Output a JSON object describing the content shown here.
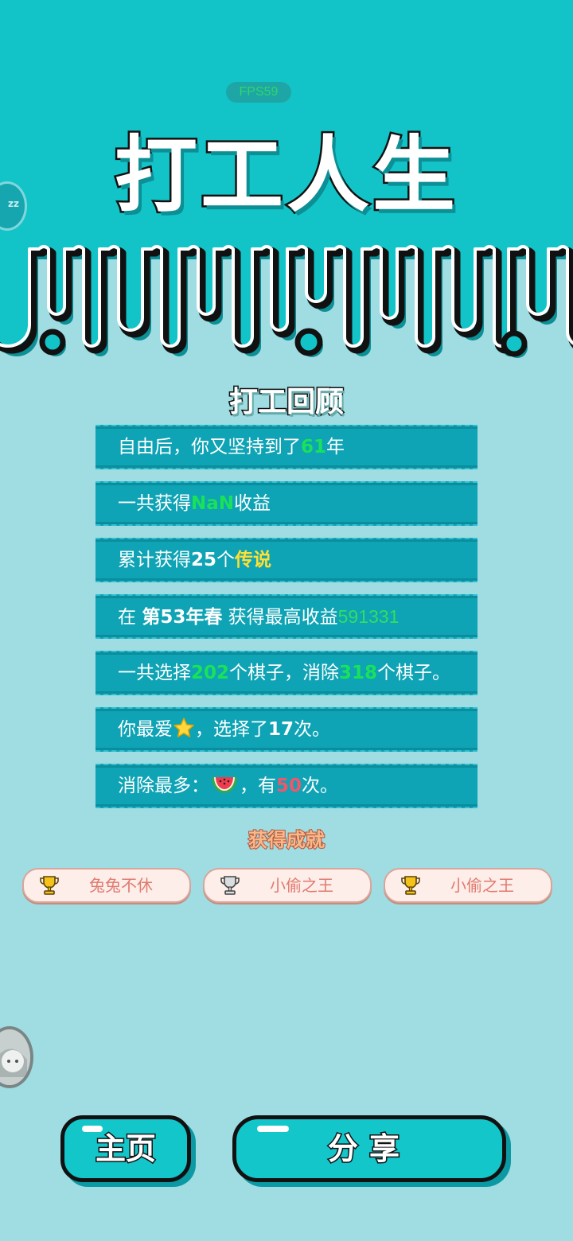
{
  "status": {
    "fps": "FPS59"
  },
  "title": "打工人生",
  "side_badge": {
    "text": "zz"
  },
  "review": {
    "heading": "打工回顾",
    "row1": {
      "pre": "自由后，你又坚持到了",
      "years": "61",
      "post": "年"
    },
    "row2": {
      "pre": "一共获得",
      "income": "NaN",
      "post": "收益"
    },
    "row3": {
      "pre": "累计获得",
      "count": "25",
      "mid": "个",
      "legend": "传说"
    },
    "row4": {
      "pre": "在 ",
      "season": "第53年春",
      "mid": " 获得最高收益",
      "income": "591331"
    },
    "row5": {
      "pre": "一共选择",
      "chosen": "202",
      "mid": "个棋子，消除",
      "removed": "318",
      "post": "个棋子。"
    },
    "row6": {
      "pre": "你最爱",
      "favorite_icon": "star-emoji",
      "mid": "，选择了",
      "times": "17",
      "post": "次。"
    },
    "row7": {
      "pre": "消除最多：",
      "piece_icon": "watermelon-emoji",
      "mid": "，有",
      "times": "50",
      "post": "次。"
    }
  },
  "achievements": {
    "heading": "获得成就",
    "items": [
      {
        "label": "兔兔不休",
        "trophy": "gold-trophy-icon"
      },
      {
        "label": "小偷之王",
        "trophy": "silver-trophy-icon"
      },
      {
        "label": "小偷之王",
        "trophy": "gold-trophy-icon"
      }
    ]
  },
  "buttons": {
    "home": "主页",
    "share": "分享"
  },
  "colors": {
    "top_band": "#12c4c8",
    "background": "#9fdde3",
    "row_fill": "#0ea3b5",
    "highlight_green": "#19e25a",
    "highlight_yellow": "#ffe033",
    "highlight_red": "#f2566a"
  }
}
